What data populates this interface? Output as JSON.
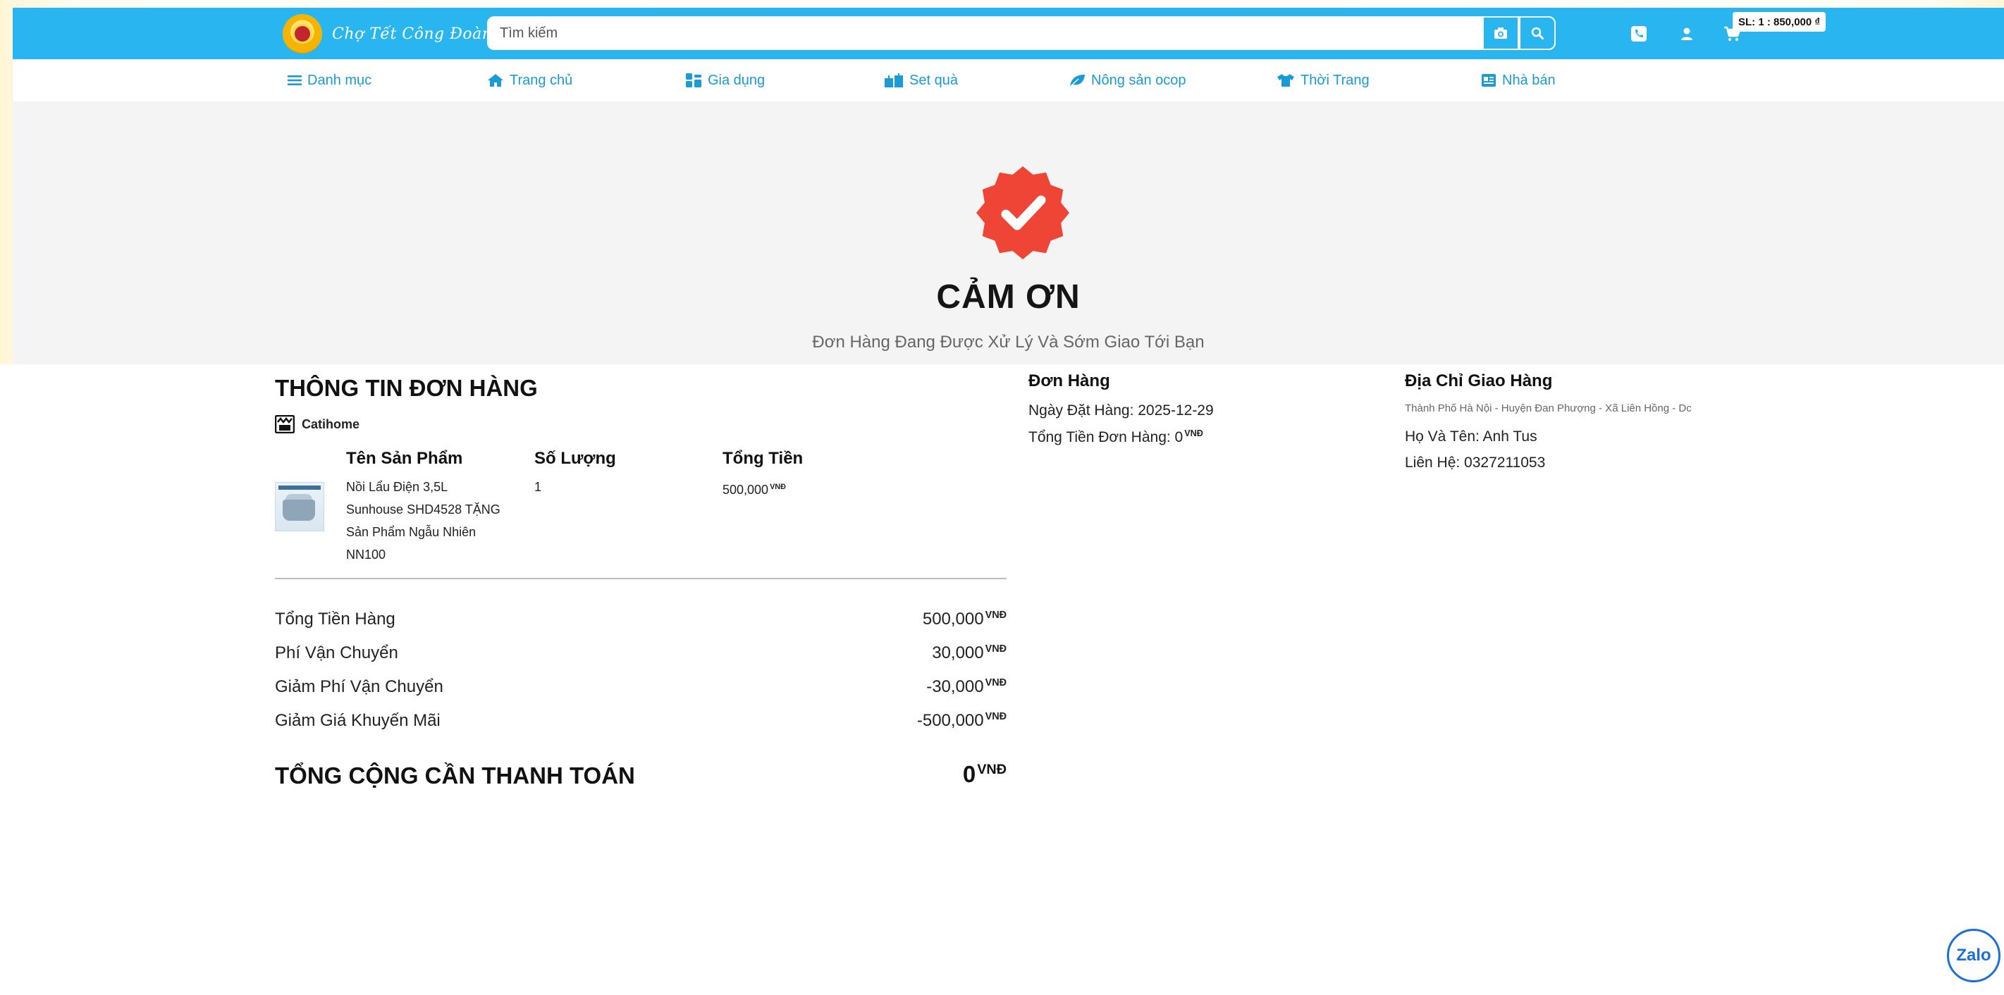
{
  "header": {
    "logo_text": "Chợ Tết Công Đoàn",
    "search_placeholder": "Tìm kiếm",
    "cart_badge": "SL: 1 : 850,000 ₫"
  },
  "nav": {
    "items": [
      {
        "label": "Danh mục",
        "icon": "menu-icon"
      },
      {
        "label": "Trang chủ",
        "icon": "home-icon"
      },
      {
        "label": "Gia dụng",
        "icon": "appliance-icon"
      },
      {
        "label": "Set quà",
        "icon": "gift-icon"
      },
      {
        "label": "Nông sản ocop",
        "icon": "leaf-icon"
      },
      {
        "label": "Thời Trang",
        "icon": "shirt-icon"
      },
      {
        "label": "Nhà bán",
        "icon": "store-icon"
      }
    ]
  },
  "hero": {
    "title": "CẢM ƠN",
    "subtitle": "Đơn Hàng Đang Được Xử Lý Và Sớm Giao Tới Bạn",
    "badge_color": "#ef4536"
  },
  "order_info": {
    "title": "THÔNG TIN ĐƠN HÀNG",
    "shop_name": "Catihome",
    "columns": [
      "Tên Sản Phẩm",
      "Số Lượng",
      "Tổng Tiền"
    ],
    "product": {
      "name_lines": [
        "Nồi Lẩu Điện 3,5L",
        "Sunhouse SHD4528 TẶNG",
        "Sản Phẩm Ngẫu Nhiên",
        "NN100"
      ],
      "quantity": "1",
      "total": "500,000",
      "total_unit": "VNĐ"
    },
    "summary": [
      {
        "label": "Tổng Tiền Hàng",
        "value": "500,000",
        "unit": "VNĐ"
      },
      {
        "label": "Phí Vận Chuyển",
        "value": "30,000",
        "unit": "VNĐ"
      },
      {
        "label": "Giảm Phí Vận Chuyển",
        "value": "-30,000",
        "unit": "VNĐ"
      },
      {
        "label": "Giảm Giá Khuyến Mãi",
        "value": "-500,000",
        "unit": "VNĐ"
      }
    ],
    "grand_total_label": "TỔNG CỘNG CẦN THANH TOÁN",
    "grand_total_value": "0",
    "grand_total_unit": "VNĐ"
  },
  "order": {
    "title": "Đơn Hàng",
    "date_line": "Ngày Đặt Hàng: 2025-12-29",
    "total_line": "Tổng Tiền Đơn Hàng: 0",
    "total_unit": "VNĐ"
  },
  "address": {
    "title": "Địa Chỉ Giao Hàng",
    "address_line": "Thành Phố Hà Nội - Huyện Đan Phượng - Xã Liên Hồng - Dc",
    "name_line": "Họ Và Tên: Anh Tus",
    "contact_line": "Liên Hệ: 0327211053"
  },
  "zalo_label": "Zalo"
}
